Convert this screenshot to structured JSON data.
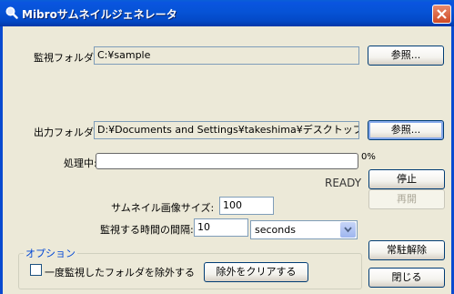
{
  "window": {
    "title": "Mibroサムネイルジェネレータ"
  },
  "watch": {
    "label": "監視フォルダ:",
    "value": "C:¥sample",
    "browse": "参照..."
  },
  "output": {
    "label": "出力フォルダ:",
    "value": "D:¥Documents and Settings¥takeshima¥デスクトップ¥OUT",
    "browse": "参照..."
  },
  "processing": {
    "label": "処理中:",
    "progress_percent": 0,
    "percent_text": "0%",
    "status": "READY"
  },
  "buttons": {
    "stop": "停止",
    "resume": "再開",
    "unresident": "常駐解除",
    "close": "閉じる"
  },
  "thumbnail": {
    "label": "サムネイル画像サイズ:",
    "value": "100"
  },
  "interval": {
    "label": "監視する時間の間隔:",
    "value": "10",
    "unit": "seconds"
  },
  "options": {
    "title": "オプション",
    "exclude_label": "一度監視したフォルダを除外する",
    "exclude_checked": false,
    "clear_button": "除外をクリアする"
  },
  "colors": {
    "titlebar": "#0653d6",
    "window_bg": "#ece9d8",
    "group_title": "#0046d5"
  }
}
